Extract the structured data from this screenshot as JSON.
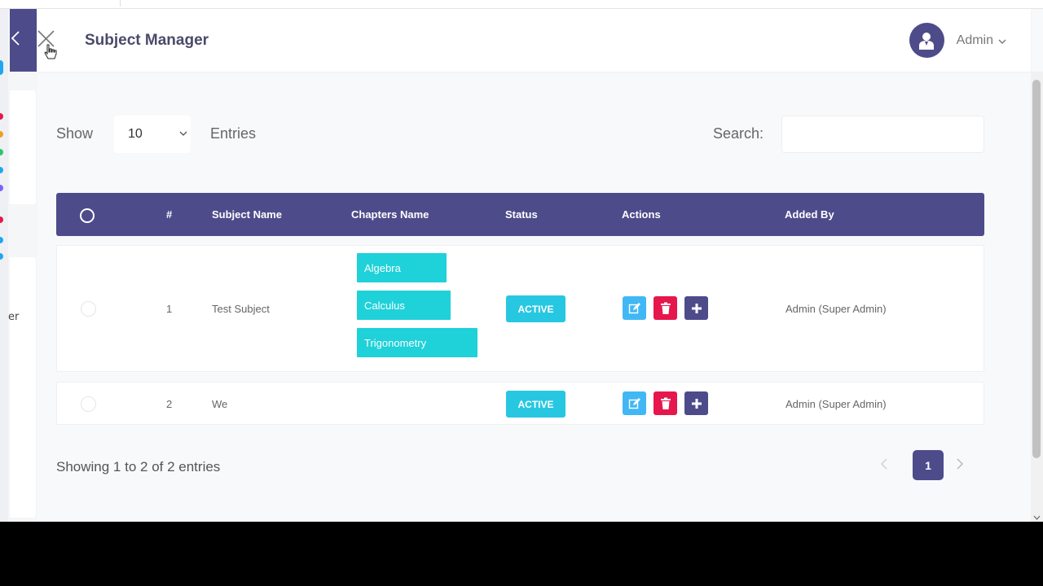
{
  "header": {
    "title": "Subject Manager",
    "user": "Admin"
  },
  "sidebar": {
    "partial_text": "er"
  },
  "controls": {
    "show_label": "Show",
    "entries_value": "10",
    "entries_label": "Entries",
    "search_label": "Search:",
    "search_value": ""
  },
  "table": {
    "columns": [
      "#",
      "Subject Name",
      "Chapters Name",
      "Status",
      "Actions",
      "Added By"
    ],
    "rows": [
      {
        "num": "1",
        "subject": "Test Subject",
        "chapters": [
          "Algebra",
          "Calculus",
          "Trigonometry"
        ],
        "status": "ACTIVE",
        "added_by": "Admin (Super Admin)"
      },
      {
        "num": "2",
        "subject": "We",
        "chapters": [],
        "status": "ACTIVE",
        "added_by": "Admin (Super Admin)"
      }
    ]
  },
  "footer": {
    "showing": "Showing 1 to 2 of 2 entries",
    "current_page": "1"
  },
  "icons": {
    "menu_toggle": "chevron-left-icon",
    "close": "close-icon",
    "avatar": "user-icon",
    "edit": "edit-icon",
    "delete": "trash-icon",
    "add": "plus-icon"
  },
  "colors": {
    "primary": "#4e4b8b",
    "chapter_badge": "#1fd1d9",
    "status_badge": "#28c7e1",
    "edit": "#41b8f5",
    "delete": "#e5174c"
  }
}
